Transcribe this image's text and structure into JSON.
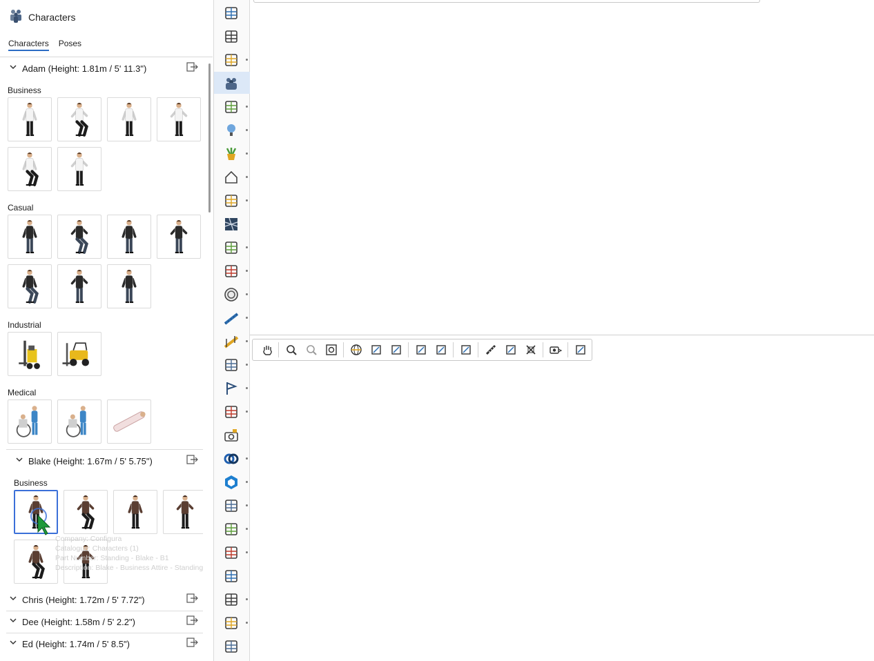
{
  "panel": {
    "title": "Characters",
    "icon": "characters-icon",
    "tabs": [
      {
        "label": "Characters",
        "active": true
      },
      {
        "label": "Poses",
        "active": false
      }
    ]
  },
  "characters": [
    {
      "name": "Adam (Height: 1.81m / 5' 11.3\")",
      "expanded": true,
      "categories": [
        {
          "label": "Business",
          "thumbs": 6,
          "figure": "white-shirt"
        },
        {
          "label": "Casual",
          "thumbs": 7,
          "figure": "black-tshirt"
        },
        {
          "label": "Industrial",
          "thumbs": 2,
          "figure": "forklift"
        },
        {
          "label": "Medical",
          "thumbs": 3,
          "figure": "wheelchair"
        }
      ]
    },
    {
      "name": "Blake (Height: 1.67m / 5' 5.75\")",
      "expanded": true,
      "categories": [
        {
          "label": "Business",
          "thumbs": 6,
          "figure": "brown-jacket",
          "selected_index": 0
        }
      ]
    },
    {
      "name": "Chris (Height: 1.72m / 5' 7.72\")",
      "expanded": false
    },
    {
      "name": "Dee (Height: 1.58m / 5' 2.2\")",
      "expanded": false
    },
    {
      "name": "Ed (Height: 1.74m / 5' 8.5\")",
      "expanded": false
    }
  ],
  "tooltip": {
    "company": "Company: Configura",
    "catalogue": "Catalogue: Characters (1)",
    "part_number": "Part Number: Standing - Blake - B1",
    "description": "Description: Blake - Business Attire - Standing"
  },
  "iconbar": [
    {
      "name": "vr-glasses-icon",
      "dot": false
    },
    {
      "name": "tools-ruler-icon",
      "dot": false
    },
    {
      "name": "bath-icon",
      "dot": true
    },
    {
      "name": "characters-icon",
      "dot": false,
      "active": true
    },
    {
      "name": "kitchen-utensils-icon",
      "dot": true
    },
    {
      "name": "lightbulb-icon",
      "dot": true
    },
    {
      "name": "plant-pot-icon",
      "dot": true
    },
    {
      "name": "house-icon",
      "dot": true
    },
    {
      "name": "laptop-icon",
      "dot": true
    },
    {
      "name": "texture-grid-icon",
      "dot": false
    },
    {
      "name": "robot-arm-icon",
      "dot": true
    },
    {
      "name": "lamp-icon",
      "dot": true
    },
    {
      "name": "fan-circle-icon",
      "dot": true
    },
    {
      "name": "conveyor-blue-icon",
      "dot": true
    },
    {
      "name": "conveyor-yellow-icon",
      "dot": true
    },
    {
      "name": "rack-storage-icon",
      "dot": true
    },
    {
      "name": "flag-icon",
      "dot": true
    },
    {
      "name": "cube-3d-icon",
      "dot": true
    },
    {
      "name": "camera-icon",
      "dot": false
    },
    {
      "name": "rings-icon",
      "dot": true
    },
    {
      "name": "sketchup-icon",
      "dot": true
    },
    {
      "name": "pallet-rack-icon",
      "dot": true
    },
    {
      "name": "shelf-frame-icon",
      "dot": true
    },
    {
      "name": "ladder-rack-icon",
      "dot": true
    },
    {
      "name": "bench-icon",
      "dot": false
    },
    {
      "name": "grid-shelf-icon",
      "dot": true
    },
    {
      "name": "cabinet-grid-icon",
      "dot": true
    },
    {
      "name": "drawer-stack-icon",
      "dot": false
    }
  ],
  "viewport_toolbar": [
    "pan-hand-icon",
    "|",
    "zoom-in-icon",
    "zoom-out-icon",
    "zoom-extents-icon",
    "|",
    "orbit-globe-icon",
    "fit-view-icon",
    "walk-view-icon",
    "|",
    "select-arrow-icon",
    "select-window-icon",
    "|",
    "snap-corner-icon",
    "|",
    "measure-ruler-icon",
    "copy-select-icon",
    "delete-x-icon",
    "|",
    "camera-dropdown-icon",
    "|",
    "focus-target-icon"
  ]
}
